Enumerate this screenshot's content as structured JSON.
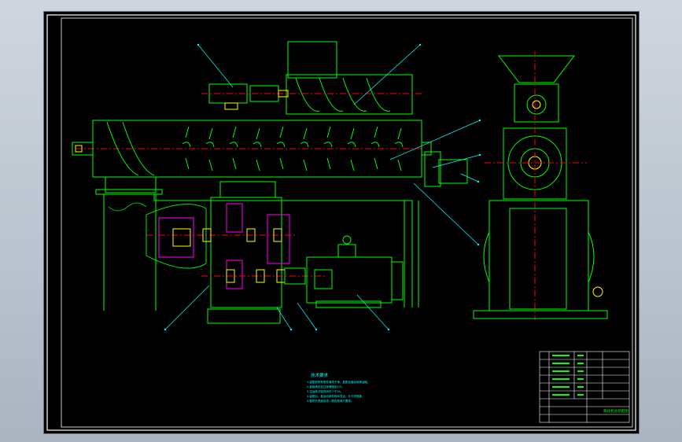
{
  "viewport": {
    "background": "#000000",
    "line_colors": {
      "frame": "#ffffff",
      "outline": "#00ff00",
      "hatch": "#ff00ff",
      "centerline": "#ff0000",
      "leader": "#00ffff",
      "bearing": "#ffff00",
      "tech_text": "#00ffff",
      "title_block": "#ffffff"
    }
  },
  "technical_requirements": {
    "heading": "技术要求",
    "lines": [
      "1.装配前所有零件清洗干净，各配合面涂润滑油脂。",
      "2.各轴承处加注润滑脂至1/3。",
      "3.空运转试验时间不少于2h。",
      "4.装配后，各运动部件转动灵活，无卡滞现象。",
      "5.整机外表面涂漆，颜色按用户要求。"
    ]
  },
  "title_block": {
    "drawing_title": "膨化机总装配图"
  }
}
